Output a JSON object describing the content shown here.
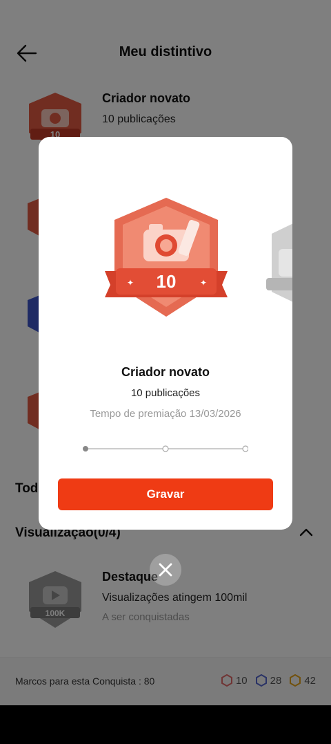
{
  "header": {
    "title": "Meu distintivo",
    "back_icon": "arrow-left-icon"
  },
  "background_list": [
    {
      "name": "Criador novato",
      "sub": "10 publicações",
      "color": "#e25a43"
    }
  ],
  "section": {
    "todos_label": "Tod",
    "views_label": "Visualizaçao(0/4)"
  },
  "highlight": {
    "name": "Destaque",
    "sub": "Visualizações atingem 100mil",
    "status": "A ser conquistadas",
    "badge_text": "100K"
  },
  "bottom": {
    "label": "Marcos para esta Conquista : 80",
    "stats": [
      {
        "icon": "red-hexagon-icon",
        "value": "10",
        "color": "#e06a6a"
      },
      {
        "icon": "blue-hexagon-icon",
        "value": "28",
        "color": "#5566cc"
      },
      {
        "icon": "gold-hexagon-icon",
        "value": "42",
        "color": "#e3a21a"
      }
    ]
  },
  "modal": {
    "badge_number": "10",
    "name": "Criador novato",
    "sub": "10 publicações",
    "date": "Tempo de premiação 13/03/2026",
    "button": "Gravar",
    "accent": "#ef3b14",
    "progress_steps": 3,
    "progress_current": 1
  }
}
